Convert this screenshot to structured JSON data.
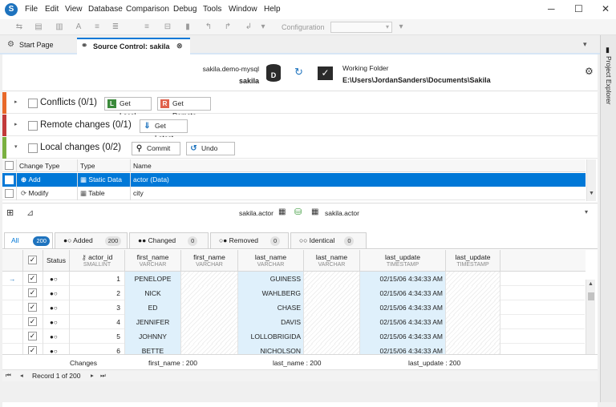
{
  "menu": [
    "File",
    "Edit",
    "View",
    "Database",
    "Comparison",
    "Debug",
    "Tools",
    "Window",
    "Help"
  ],
  "toolbar": {
    "configuration_label": "Configuration"
  },
  "tabs": [
    {
      "label": "Start Page",
      "icon": "gear-icon"
    },
    {
      "label": "Source Control: sakila",
      "icon": "source-control-icon"
    }
  ],
  "right_panel": {
    "label": "Project Explorer"
  },
  "header": {
    "server": "sakila.demo-mysql",
    "database": "sakila",
    "working_folder_label": "Working Folder",
    "working_folder_path": "E:\\Users\\JordanSanders\\Documents\\Sakila"
  },
  "sections": [
    {
      "title": "Conflicts (0/1)",
      "button1": "Get Local",
      "button2": "Get Remote",
      "color": "#e8692a"
    },
    {
      "title": "Remote changes (0/1)",
      "button1": "Get Latest",
      "color": "#c23a3a"
    },
    {
      "title": "Local changes (0/2)",
      "button1": "Commit",
      "button2": "Undo",
      "color": "#7ab040"
    }
  ],
  "changes_grid": {
    "columns": [
      "Change Type",
      "Type",
      "Name"
    ],
    "rows": [
      {
        "change": "Add",
        "type": "Static Data",
        "name": "actor (Data)"
      },
      {
        "change": "Modify",
        "type": "Table",
        "name": "city"
      }
    ]
  },
  "compare": {
    "left": "sakila.actor",
    "right": "sakila.actor"
  },
  "filter_tabs": [
    {
      "label": "All",
      "count": "200"
    },
    {
      "label": "Added",
      "count": "200"
    },
    {
      "label": "Changed",
      "count": "0"
    },
    {
      "label": "Removed",
      "count": "0"
    },
    {
      "label": "Identical",
      "count": "0"
    }
  ],
  "data_grid": {
    "status_header": "Status",
    "columns": [
      {
        "name": "actor_id",
        "type": "SMALLINT"
      },
      {
        "name": "first_name",
        "type": "VARCHAR"
      },
      {
        "name": "first_name",
        "type": "VARCHAR"
      },
      {
        "name": "last_name",
        "type": "VARCHAR"
      },
      {
        "name": "last_name",
        "type": "VARCHAR"
      },
      {
        "name": "last_update",
        "type": "TIMESTAMP"
      },
      {
        "name": "last_update",
        "type": "TIMESTAMP"
      }
    ],
    "rows": [
      {
        "id": "1",
        "first": "PENELOPE",
        "last": "GUINESS",
        "upd": "02/15/06 4:34:33 AM"
      },
      {
        "id": "2",
        "first": "NICK",
        "last": "WAHLBERG",
        "upd": "02/15/06 4:34:33 AM"
      },
      {
        "id": "3",
        "first": "ED",
        "last": "CHASE",
        "upd": "02/15/06 4:34:33 AM"
      },
      {
        "id": "4",
        "first": "JENNIFER",
        "last": "DAVIS",
        "upd": "02/15/06 4:34:33 AM"
      },
      {
        "id": "5",
        "first": "JOHNNY",
        "last": "LOLLOBRIGIDA",
        "upd": "02/15/06 4:34:33 AM"
      },
      {
        "id": "6",
        "first": "BETTE",
        "last": "NICHOLSON",
        "upd": "02/15/06 4:34:33 AM"
      }
    ]
  },
  "summary": {
    "changes": "Changes",
    "first_name": "first_name : 200",
    "last_name": "last_name : 200",
    "last_update": "last_update : 200"
  },
  "nav": {
    "record": "Record 1 of 200"
  },
  "colors": {
    "accent": "#0078d7",
    "added_bg": "#dff0fb"
  }
}
